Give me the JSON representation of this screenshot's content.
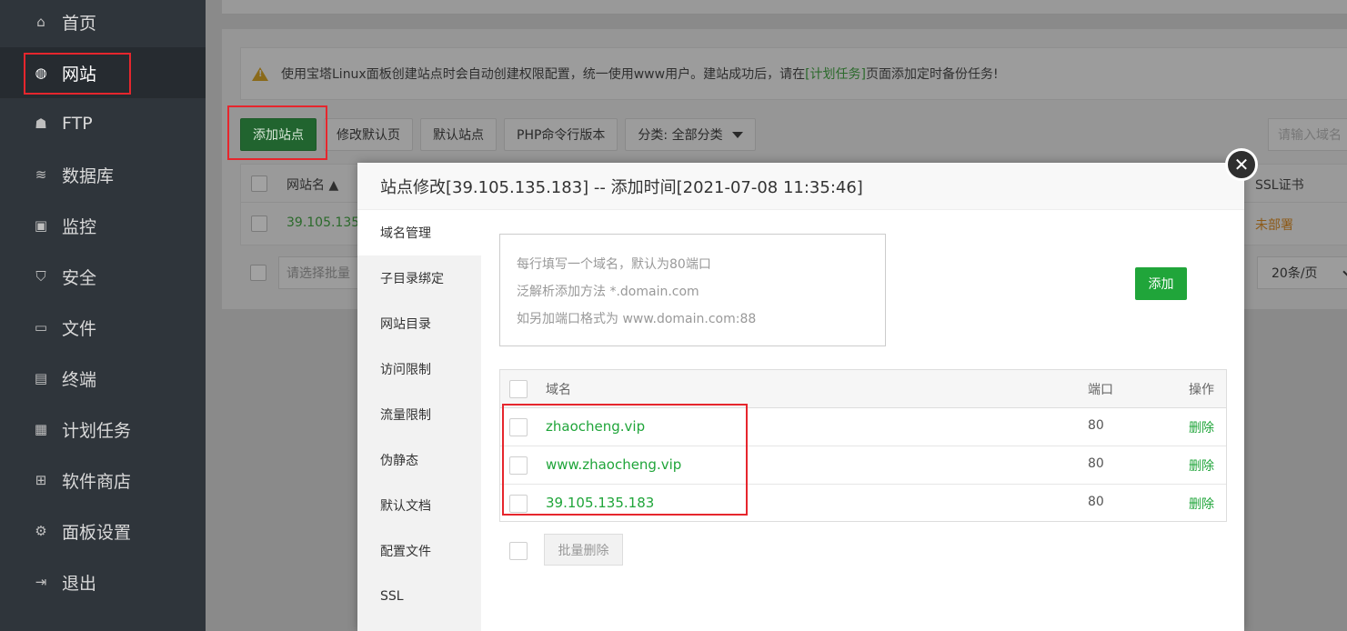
{
  "sidebar": {
    "items": [
      {
        "label": "首页",
        "icon": "home-icon",
        "glyph": "⌂"
      },
      {
        "label": "网站",
        "icon": "globe-icon",
        "glyph": "◍",
        "active": true
      },
      {
        "label": "FTP",
        "icon": "ftp-icon",
        "glyph": "☗"
      },
      {
        "label": "数据库",
        "icon": "database-icon",
        "glyph": "≋"
      },
      {
        "label": "监控",
        "icon": "monitor-icon",
        "glyph": "▣"
      },
      {
        "label": "安全",
        "icon": "shield-icon",
        "glyph": "⛉"
      },
      {
        "label": "文件",
        "icon": "folder-icon",
        "glyph": "▭"
      },
      {
        "label": "终端",
        "icon": "terminal-icon",
        "glyph": "▤"
      },
      {
        "label": "计划任务",
        "icon": "calendar-icon",
        "glyph": "▦"
      },
      {
        "label": "软件商店",
        "icon": "apps-icon",
        "glyph": "⊞"
      },
      {
        "label": "面板设置",
        "icon": "gear-icon",
        "glyph": "⚙"
      },
      {
        "label": "退出",
        "icon": "logout-icon",
        "glyph": "⇥"
      }
    ]
  },
  "notice": {
    "text_before": "使用宝塔Linux面板创建站点时会自动创建权限配置，统一使用www用户。建站成功后，请在",
    "link": "[计划任务]",
    "text_after": "页面添加定时备份任务!"
  },
  "toolbar": {
    "add_site": "添加站点",
    "modify_default_page": "修改默认页",
    "default_site": "默认站点",
    "php_cli_version": "PHP命令行版本",
    "category": "分类: 全部分类",
    "search_placeholder": "请输入域名"
  },
  "sites_table": {
    "col_name": "网站名",
    "col_ssl": "SSL证书",
    "row_name": "39.105.135",
    "row_ssl": "未部署"
  },
  "footer": {
    "batch_placeholder": "请选择批量",
    "page_size": "20条/页"
  },
  "modal": {
    "title": "站点修改[39.105.135.183] -- 添加时间[2021-07-08 11:35:46]",
    "close_glyph": "✕",
    "nav": [
      "域名管理",
      "子目录绑定",
      "网站目录",
      "访问限制",
      "流量限制",
      "伪静态",
      "默认文档",
      "配置文件",
      "SSL"
    ],
    "textarea_lines": [
      "每行填写一个域名，默认为80端口",
      "泛解析添加方法 *.domain.com",
      "如另加端口格式为 www.domain.com:88"
    ],
    "add_button": "添加",
    "table_headers": {
      "domain": "域名",
      "port": "端口",
      "action": "操作"
    },
    "rows": [
      {
        "domain": "zhaocheng.vip",
        "port": "80",
        "action": "删除"
      },
      {
        "domain": "www.zhaocheng.vip",
        "port": "80",
        "action": "删除"
      },
      {
        "domain": "39.105.135.183",
        "port": "80",
        "action": "删除"
      }
    ],
    "batch_delete": "批量删除"
  }
}
